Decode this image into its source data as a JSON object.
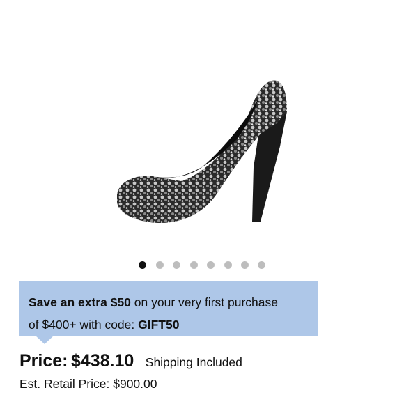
{
  "product": {
    "image_alt": "black sequin high heel pump"
  },
  "carousel": {
    "dot_count": 8,
    "active_index": 0
  },
  "promo": {
    "line1_bold": "Save an extra $50",
    "line1_rest": " on your very first purchase",
    "line2_rest": "of $400+ with code: ",
    "code": "GIFT50"
  },
  "pricing": {
    "price_label": "Price:",
    "price_value": "$438.10",
    "shipping": "Shipping Included",
    "retail_label": "Est. Retail Price:",
    "retail_value": "$900.00"
  },
  "colors": {
    "promo_bg": "#aec7e8",
    "dot_active": "#111111",
    "dot_inactive": "#bdbdbd"
  }
}
